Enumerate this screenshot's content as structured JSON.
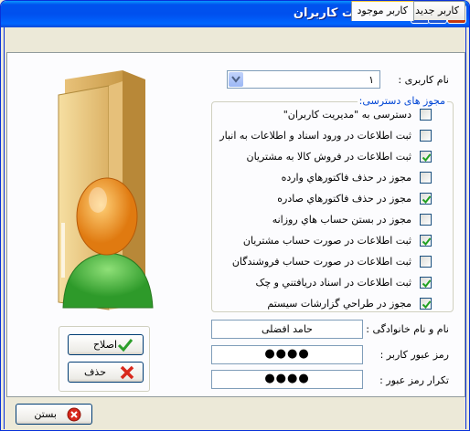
{
  "window": {
    "title": "مديريت کاربران"
  },
  "tabs": [
    {
      "label": "کاربر موجود",
      "active": true
    },
    {
      "label": "کاربر جديد",
      "active": false
    }
  ],
  "form": {
    "username_label": "نام کاربری :",
    "username_value": "۱",
    "permissions_title": "مجوز های دسترسی:",
    "permissions": [
      {
        "label": "دسترسی به \"مديريت کاربران\"",
        "checked": false
      },
      {
        "label": "ثبت اطلاعات در ورود اسناد و اطلاعات به انبار",
        "checked": false
      },
      {
        "label": "ثبت اطلاعات در فروش کالا به مشتريان",
        "checked": true
      },
      {
        "label": "مجوز در حذف فاکتورهاي وارده",
        "checked": false
      },
      {
        "label": "مجوز در حذف فاکتورهاي صادره",
        "checked": true
      },
      {
        "label": "مجوز در بستن حساب هاي روزانه",
        "checked": false
      },
      {
        "label": "ثبت اطلاعات در صورت حساب مشتريان",
        "checked": true
      },
      {
        "label": "ثبت اطلاعات در صورت حساب فروشندگان",
        "checked": false
      },
      {
        "label": "ثبت اطلاعات در اسناد دريافتني و چک",
        "checked": true
      },
      {
        "label": "مجوز در طراحي گزارشات سيستم",
        "checked": true
      }
    ],
    "fullname_label": "نام و نام خانوادگی :",
    "fullname_value": "حامد افضلی",
    "password_label": "رمز عبور کاربر :",
    "password_value": "●●●●",
    "confirm_label": "تکرار رمز عبور :",
    "confirm_value": "●●●●"
  },
  "buttons": {
    "edit": "اصلاح",
    "delete": "حذف",
    "close": "بستن"
  },
  "colors": {
    "titlebar": "#0053ee",
    "group_title": "#0046d5",
    "check": "#21a121",
    "panel": "#fcfcfe"
  }
}
